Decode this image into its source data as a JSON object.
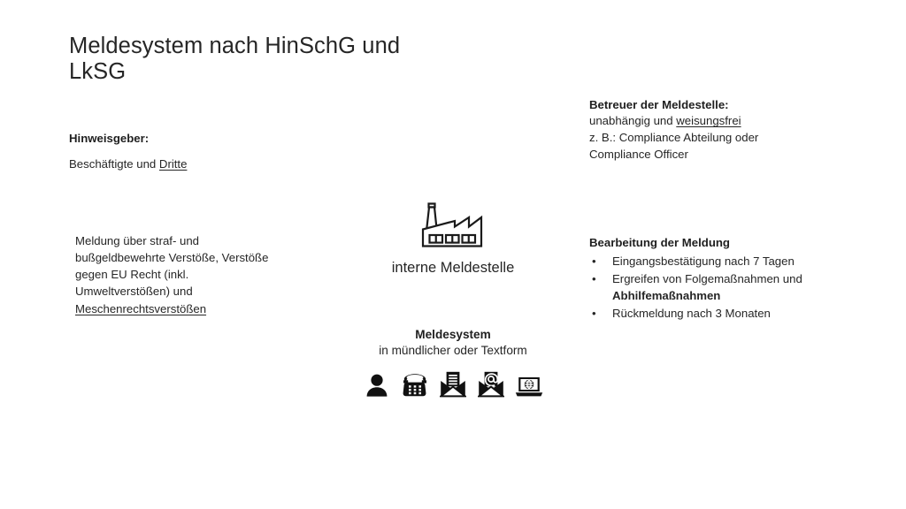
{
  "slide": {
    "title": "Meldesystem nach HinSchG und\nLkSG",
    "background_color": "#ffffff",
    "text_color": "#262626"
  },
  "hinweisgeber": {
    "heading": "Hinweisgeber:",
    "line_prefix": "Beschäftigte und ",
    "line_underlined": "Dritte"
  },
  "meldung": {
    "line1": "Meldung über straf- und",
    "line2": "bußgeldbewehrte Verstöße, Verstöße",
    "line3": "gegen EU Recht (inkl.",
    "line4": "Umweltverstößen) und",
    "line5_underlined": "Meschenrechtsverstößen"
  },
  "betreuer": {
    "heading": "Betreuer der Meldestelle:",
    "line1_prefix": "unabhängig und ",
    "line1_underlined": "weisungsfrei",
    "line2": "z. B.: Compliance Abteilung oder",
    "line3": "Compliance Officer"
  },
  "bearbeitung": {
    "heading": "Bearbeitung der Meldung",
    "bullet_glyph": "•",
    "items": [
      {
        "text": "Eingangsbestätigung nach 7 Tagen",
        "bold_text": ""
      },
      {
        "text": "Ergreifen von Folgemaßnahmen und ",
        "bold_text": "Abhilfemaßnahmen"
      },
      {
        "text": "Rückmeldung nach 3 Monaten",
        "bold_text": ""
      }
    ]
  },
  "center": {
    "factory_icon_name": "factory-icon",
    "meldestelle_label": "interne Meldestelle",
    "meldesystem_title": "Meldesystem",
    "meldesystem_subtitle": "in mündlicher oder Textform",
    "channels": [
      {
        "icon": "person-icon",
        "label": "persönlich"
      },
      {
        "icon": "telephone-icon",
        "label": "Telefon"
      },
      {
        "icon": "letter-icon",
        "label": "Brief"
      },
      {
        "icon": "email-icon",
        "label": "E-Mail"
      },
      {
        "icon": "laptop-web-icon",
        "label": "Online"
      }
    ]
  }
}
